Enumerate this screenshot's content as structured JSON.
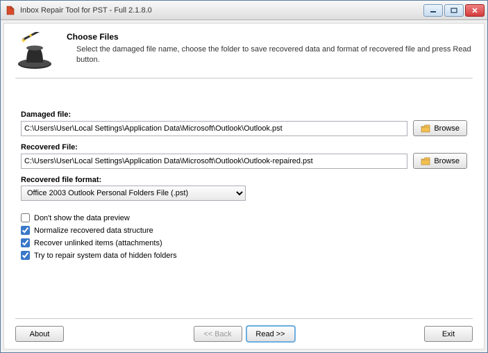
{
  "window": {
    "title": "Inbox Repair Tool for PST - Full 2.1.8.0"
  },
  "header": {
    "title": "Choose Files",
    "description": "Select the damaged file name, choose the folder to save recovered data and format of recovered file and press Read button."
  },
  "fields": {
    "damaged_label": "Damaged file:",
    "damaged_value": "C:\\Users\\User\\Local Settings\\Application Data\\Microsoft\\Outlook\\Outlook.pst",
    "recovered_label": "Recovered File:",
    "recovered_value": "C:\\Users\\User\\Local Settings\\Application Data\\Microsoft\\Outlook\\Outlook-repaired.pst",
    "format_label": "Recovered file format:",
    "format_value": "Office 2003 Outlook Personal Folders File (.pst)"
  },
  "buttons": {
    "browse": "Browse",
    "about": "About",
    "back": "<< Back",
    "read": "Read >>",
    "exit": "Exit"
  },
  "checkboxes": {
    "preview": {
      "label": "Don't show the data preview",
      "checked": false
    },
    "normalize": {
      "label": "Normalize recovered data structure",
      "checked": true
    },
    "unlinked": {
      "label": "Recover unlinked items (attachments)",
      "checked": true
    },
    "hidden": {
      "label": "Try to repair system data of hidden folders",
      "checked": true
    }
  }
}
